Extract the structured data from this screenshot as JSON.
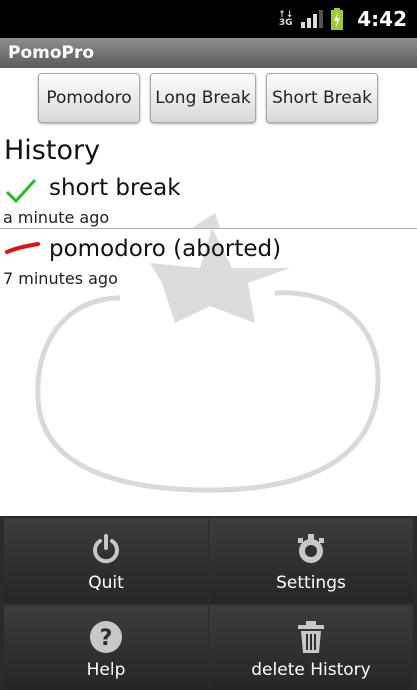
{
  "status": {
    "time": "4:42",
    "network": "3G"
  },
  "app": {
    "title": "PomoPro"
  },
  "buttons": {
    "pomodoro": "Pomodoro",
    "long_break": "Long Break",
    "short_break": "Short Break"
  },
  "history": {
    "heading": "History",
    "items": [
      {
        "title": "short break",
        "time": "a minute ago",
        "status_icon": "check-icon",
        "color": "#1fbf1f"
      },
      {
        "title": "pomodoro (aborted)",
        "time": "7 minutes ago",
        "status_icon": "dash-icon",
        "color": "#e01010"
      }
    ]
  },
  "menu": {
    "items": [
      {
        "label": "Quit",
        "icon": "power-icon"
      },
      {
        "label": "Settings",
        "icon": "gear-icon"
      },
      {
        "label": "Help",
        "icon": "help-icon"
      },
      {
        "label": "delete History",
        "icon": "trash-icon"
      }
    ]
  }
}
